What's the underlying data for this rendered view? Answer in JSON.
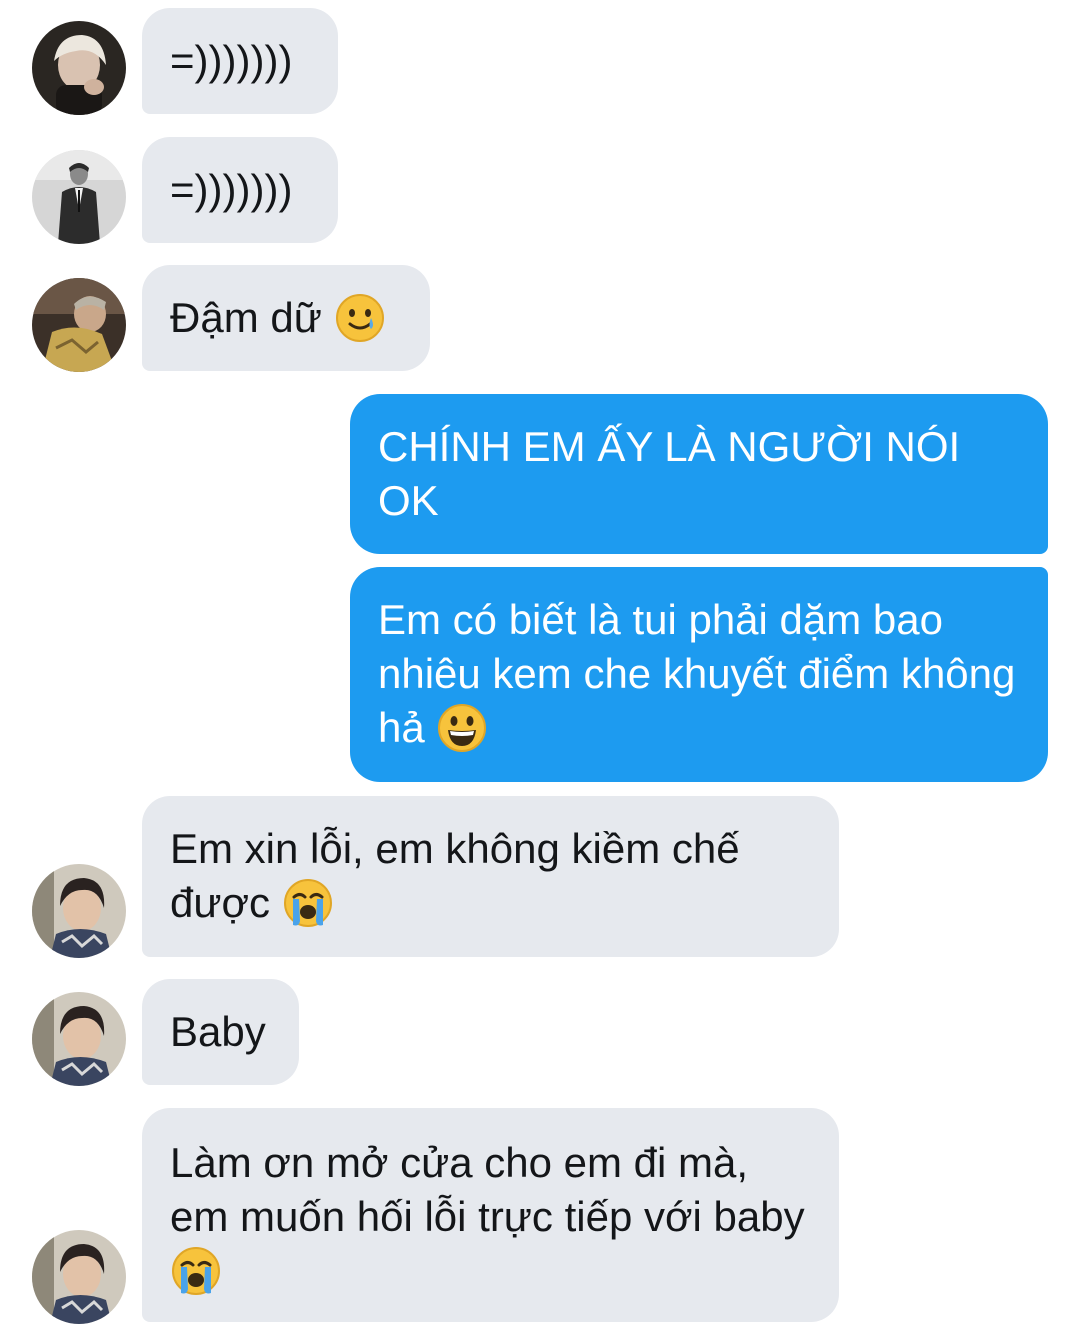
{
  "conversation": {
    "messages": [
      {
        "direction": "incoming",
        "avatar": "user-a-avatar",
        "text": "=)))))))"
      },
      {
        "direction": "incoming",
        "avatar": "user-b-avatar",
        "text": "=)))))))"
      },
      {
        "direction": "incoming",
        "avatar": "user-c-avatar",
        "text": "Đậm dữ",
        "emoji": "smiling-face-with-tear-icon"
      },
      {
        "direction": "outgoing",
        "text": "CHÍNH EM ẤY LÀ NGƯỜI NÓI OK"
      },
      {
        "direction": "outgoing",
        "text": "Em có biết là tui phải dặm bao nhiêu kem che khuyết điểm không hả",
        "emoji": "grinning-face-icon"
      },
      {
        "direction": "incoming",
        "avatar": "user-d-avatar",
        "text": "Em xin lỗi, em không kiềm chế được",
        "emoji": "loudly-crying-face-icon"
      },
      {
        "direction": "incoming",
        "avatar": "user-d-avatar",
        "text": "Baby"
      },
      {
        "direction": "incoming",
        "avatar": "user-d-avatar",
        "text": "Làm ơn mở cửa cho em đi mà, em muốn hối lỗi trực tiếp với baby",
        "emoji": "loudly-crying-face-icon"
      }
    ]
  },
  "colors": {
    "incoming_bubble": "#e6e9ee",
    "outgoing_bubble": "#1d9bf0",
    "incoming_text": "#141619",
    "outgoing_text": "#ffffff"
  }
}
